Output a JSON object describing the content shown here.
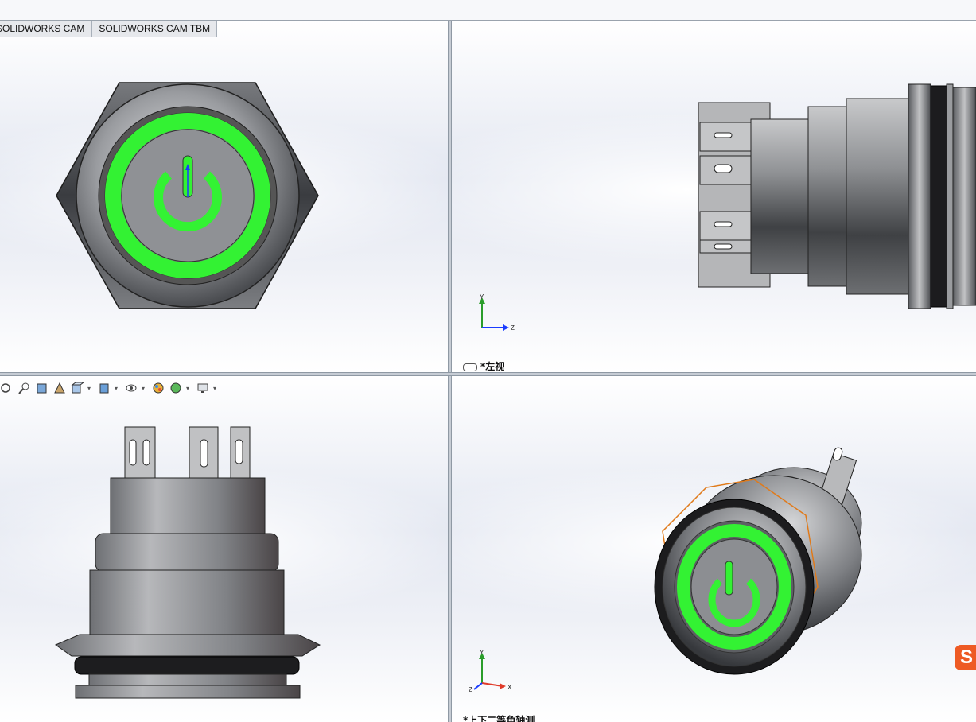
{
  "tabs": [
    {
      "label": "SOLIDWORKS CAM"
    },
    {
      "label": "SOLIDWORKS CAM TBM"
    }
  ],
  "viewports": {
    "left_view": {
      "label": "*左视"
    },
    "iso_view": {
      "label": "*上下二等角轴测"
    }
  },
  "triad": {
    "y": "Y",
    "z": "Z",
    "x": "X"
  },
  "colors": {
    "glow": "#33f233",
    "steel": "#8a8d92",
    "selection": "#e07a1a"
  },
  "hud_icons": [
    "zoom-fit-icon",
    "zoom-area-icon",
    "previous-view-icon",
    "section-view-icon",
    "view-orientation-icon",
    "display-style-icon",
    "hide-show-items-icon",
    "edit-appearance-icon",
    "apply-scene-icon",
    "view-settings-icon"
  ],
  "watermark": "S"
}
